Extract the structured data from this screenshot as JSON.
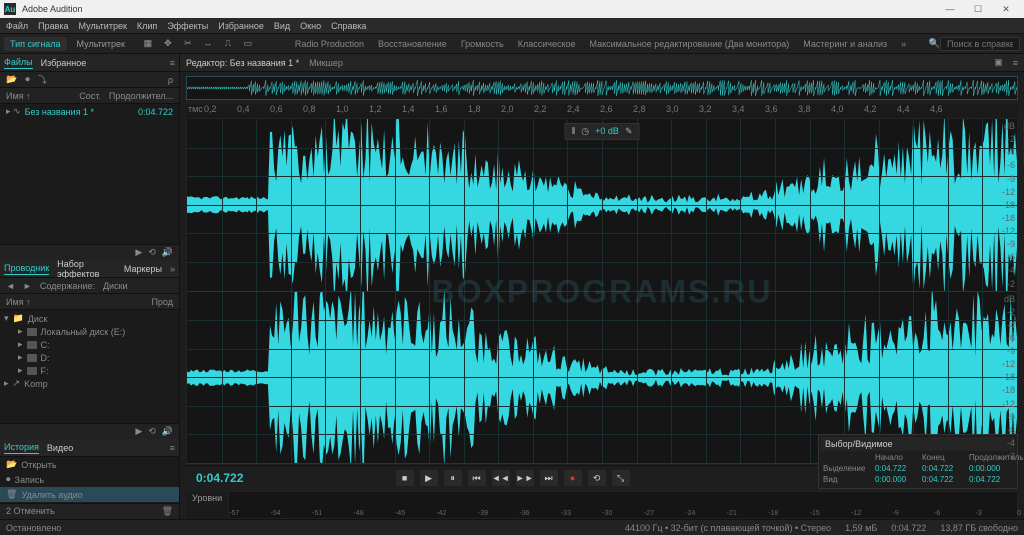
{
  "window": {
    "title": "Adobe Audition"
  },
  "menu": [
    "Файл",
    "Правка",
    "Мультитрек",
    "Клип",
    "Эффекты",
    "Избранное",
    "Вид",
    "Окно",
    "Справка"
  ],
  "toolbar": {
    "tab_waveform": "Тип сигнала",
    "tab_multitrack": "Мультитрек",
    "workspaces": [
      "Radio Production",
      "Восстановление",
      "Громкость",
      "Классическое",
      "Максимальное редактирование (Два монитора)",
      "Мастеринг и анализ"
    ],
    "search_placeholder": "Поиск в справке"
  },
  "files_panel": {
    "tabs": [
      "Файлы",
      "Избранное"
    ],
    "cols": {
      "name": "Имя ↑",
      "status": "Сост.",
      "duration": "Продолжител..."
    },
    "items": [
      {
        "name": "Без названия 1 *",
        "duration": "0:04.722"
      }
    ]
  },
  "browser_panel": {
    "tabs": [
      "Проводник",
      "Набор эффектов",
      "Маркеры"
    ],
    "sub": {
      "content": "Содержание:",
      "drives": "Диски"
    },
    "cols": {
      "name": "Имя ↑",
      "prod": "Прод"
    },
    "tree": [
      {
        "label": "Диск",
        "children": [
          {
            "label": "Локальный диск (E:)"
          },
          {
            "label": "C:"
          },
          {
            "label": "D:"
          },
          {
            "label": "F:"
          }
        ]
      },
      {
        "label": "Komp"
      }
    ]
  },
  "history_panel": {
    "tabs": [
      "История",
      "Видео"
    ],
    "items": [
      {
        "label": "Открыть"
      },
      {
        "label": "Запись"
      },
      {
        "label": "Удалить аудио",
        "selected": true
      }
    ],
    "undo": "2 Отменить"
  },
  "editor": {
    "tabs": [
      "Редактор: Без названия 1 *",
      "Микшер"
    ],
    "hud": {
      "vol": "+0 dB"
    },
    "ruler_unit": "тмс",
    "ruler_ticks": [
      "0,2",
      "0,4",
      "0,6",
      "0,8",
      "1,0",
      "1,2",
      "1,4",
      "1,6",
      "1,8",
      "2,0",
      "2,2",
      "2,4",
      "2,6",
      "2,8",
      "3,0",
      "3,2",
      "3,4",
      "3,6",
      "3,8",
      "4,0",
      "4,2",
      "4,4",
      "4,6"
    ],
    "db_marks": [
      "dB",
      "-2",
      "-4",
      "-6",
      "-9",
      "-12",
      "-18",
      "-18",
      "-12",
      "-9",
      "-6",
      "-4",
      "-2"
    ],
    "timecode": "0:04.722"
  },
  "levels": {
    "label": "Уровни",
    "marks": [
      "-57",
      "-54",
      "-51",
      "-48",
      "-45",
      "-42",
      "-39",
      "-36",
      "-33",
      "-30",
      "-27",
      "-24",
      "-21",
      "-18",
      "-15",
      "-12",
      "-9",
      "-6",
      "-3",
      "0"
    ]
  },
  "selection": {
    "title": "Выбор/Видимое",
    "cols": [
      "",
      "Начало",
      "Конец",
      "Продолжительность"
    ],
    "rows": [
      {
        "label": "Выделение",
        "start": "0:04.722",
        "end": "0:04.722",
        "dur": "0:00.000"
      },
      {
        "label": "Вид",
        "start": "0:00.000",
        "end": "0:04.722",
        "dur": "0:04.722"
      }
    ]
  },
  "status": {
    "left": "Остановлено",
    "sample": "44100 Гц • 32-бит (с плавающей точкой) • Стерео",
    "size": "1,59 мБ",
    "dur": "0:04.722",
    "free": "13,87 ГБ свободно"
  },
  "watermark": "BOXPROGRAMS.RU"
}
